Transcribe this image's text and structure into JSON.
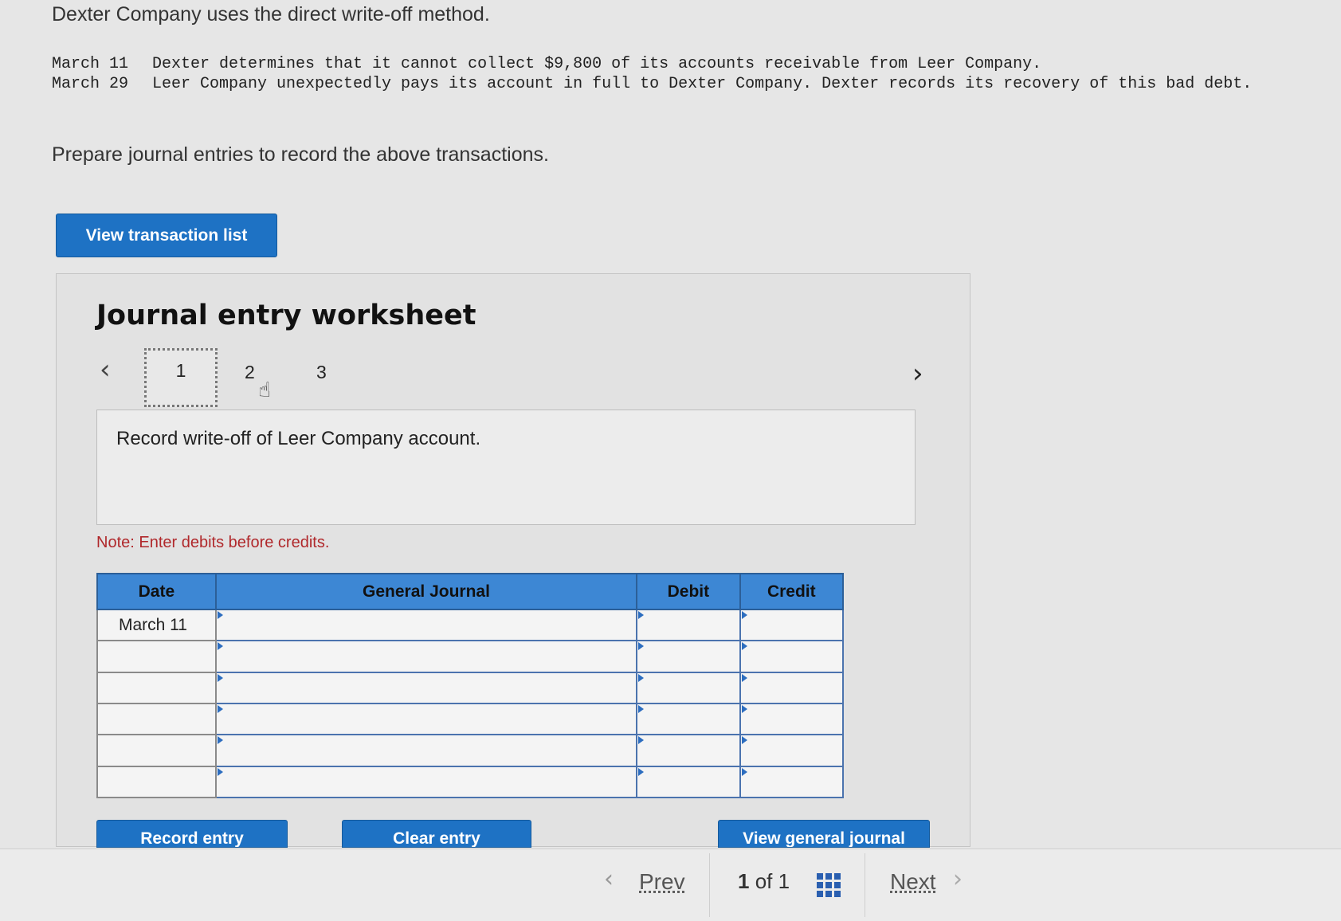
{
  "intro": "Dexter Company uses the direct write-off method.",
  "transactions": [
    {
      "date": "March 11",
      "text": "Dexter determines that it cannot collect $9,800 of its accounts receivable from Leer Company."
    },
    {
      "date": "March 29",
      "text": "Leer Company unexpectedly pays its account in full to Dexter Company. Dexter records its recovery of this bad debt."
    }
  ],
  "prompt": "Prepare journal entries to record the above transactions.",
  "view_transaction_list": "View transaction list",
  "worksheet": {
    "title": "Journal entry worksheet",
    "steps": [
      "1",
      "2",
      "3"
    ],
    "active_step": "1",
    "description": "Record write-off of Leer Company account.",
    "note": "Note: Enter debits before credits.",
    "columns": [
      "Date",
      "General Journal",
      "Debit",
      "Credit"
    ],
    "rows": [
      {
        "date": "March 11",
        "account": "",
        "debit": "",
        "credit": ""
      },
      {
        "date": "",
        "account": "",
        "debit": "",
        "credit": ""
      },
      {
        "date": "",
        "account": "",
        "debit": "",
        "credit": ""
      },
      {
        "date": "",
        "account": "",
        "debit": "",
        "credit": ""
      },
      {
        "date": "",
        "account": "",
        "debit": "",
        "credit": ""
      },
      {
        "date": "",
        "account": "",
        "debit": "",
        "credit": ""
      }
    ],
    "buttons": {
      "record": "Record entry",
      "clear": "Clear entry",
      "view_journal": "View general journal"
    }
  },
  "footer": {
    "prev": "Prev",
    "current": "1",
    "of": "of",
    "total": "1",
    "next": "Next"
  },
  "colors": {
    "primary_button": "#1e72c4",
    "table_header": "#3d87d4",
    "note": "#b0282b"
  }
}
